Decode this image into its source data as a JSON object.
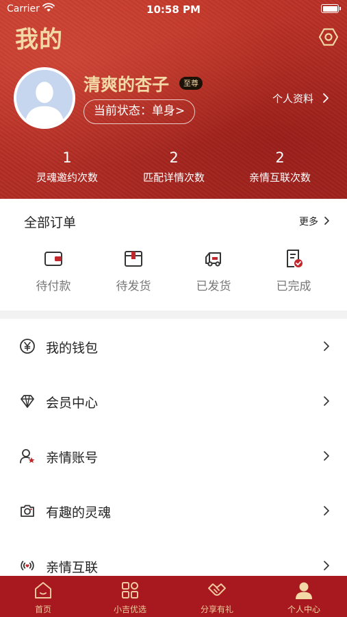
{
  "status_bar": {
    "carrier": "Carrier",
    "time": "10:58 PM"
  },
  "header": {
    "title": "我的",
    "user_name": "清爽的杏子",
    "vip_badge": "至尊",
    "status": "当前状态：单身>",
    "profile_link": "个人资料",
    "stats": [
      {
        "value": "1",
        "label": "灵魂邀约次数"
      },
      {
        "value": "2",
        "label": "匹配详情次数"
      },
      {
        "value": "2",
        "label": "亲情互联次数"
      }
    ]
  },
  "orders": {
    "title": "全部订单",
    "more": "更多",
    "items": [
      {
        "label": "待付款",
        "icon": "wallet-icon"
      },
      {
        "label": "待发货",
        "icon": "box-icon"
      },
      {
        "label": "已发货",
        "icon": "truck-icon"
      },
      {
        "label": "已完成",
        "icon": "receipt-check-icon"
      }
    ]
  },
  "menu": [
    {
      "label": "我的钱包",
      "icon": "yen-circle-icon"
    },
    {
      "label": "会员中心",
      "icon": "diamond-icon"
    },
    {
      "label": "亲情账号",
      "icon": "user-star-icon"
    },
    {
      "label": "有趣的灵魂",
      "icon": "camera-icon"
    },
    {
      "label": "亲情互联",
      "icon": "broadcast-heart-icon"
    }
  ],
  "tabbar": {
    "items": [
      {
        "label": "首页",
        "icon": "home-icon"
      },
      {
        "label": "小吉优选",
        "icon": "grid-icon"
      },
      {
        "label": "分享有礼",
        "icon": "handshake-icon"
      },
      {
        "label": "个人中心",
        "icon": "person-icon"
      }
    ],
    "active_index": 3
  },
  "colors": {
    "header_red": "#b52d24",
    "gold": "#f3d9a6",
    "tabbar_red": "#a8191f",
    "icon_red": "#c0282e"
  }
}
